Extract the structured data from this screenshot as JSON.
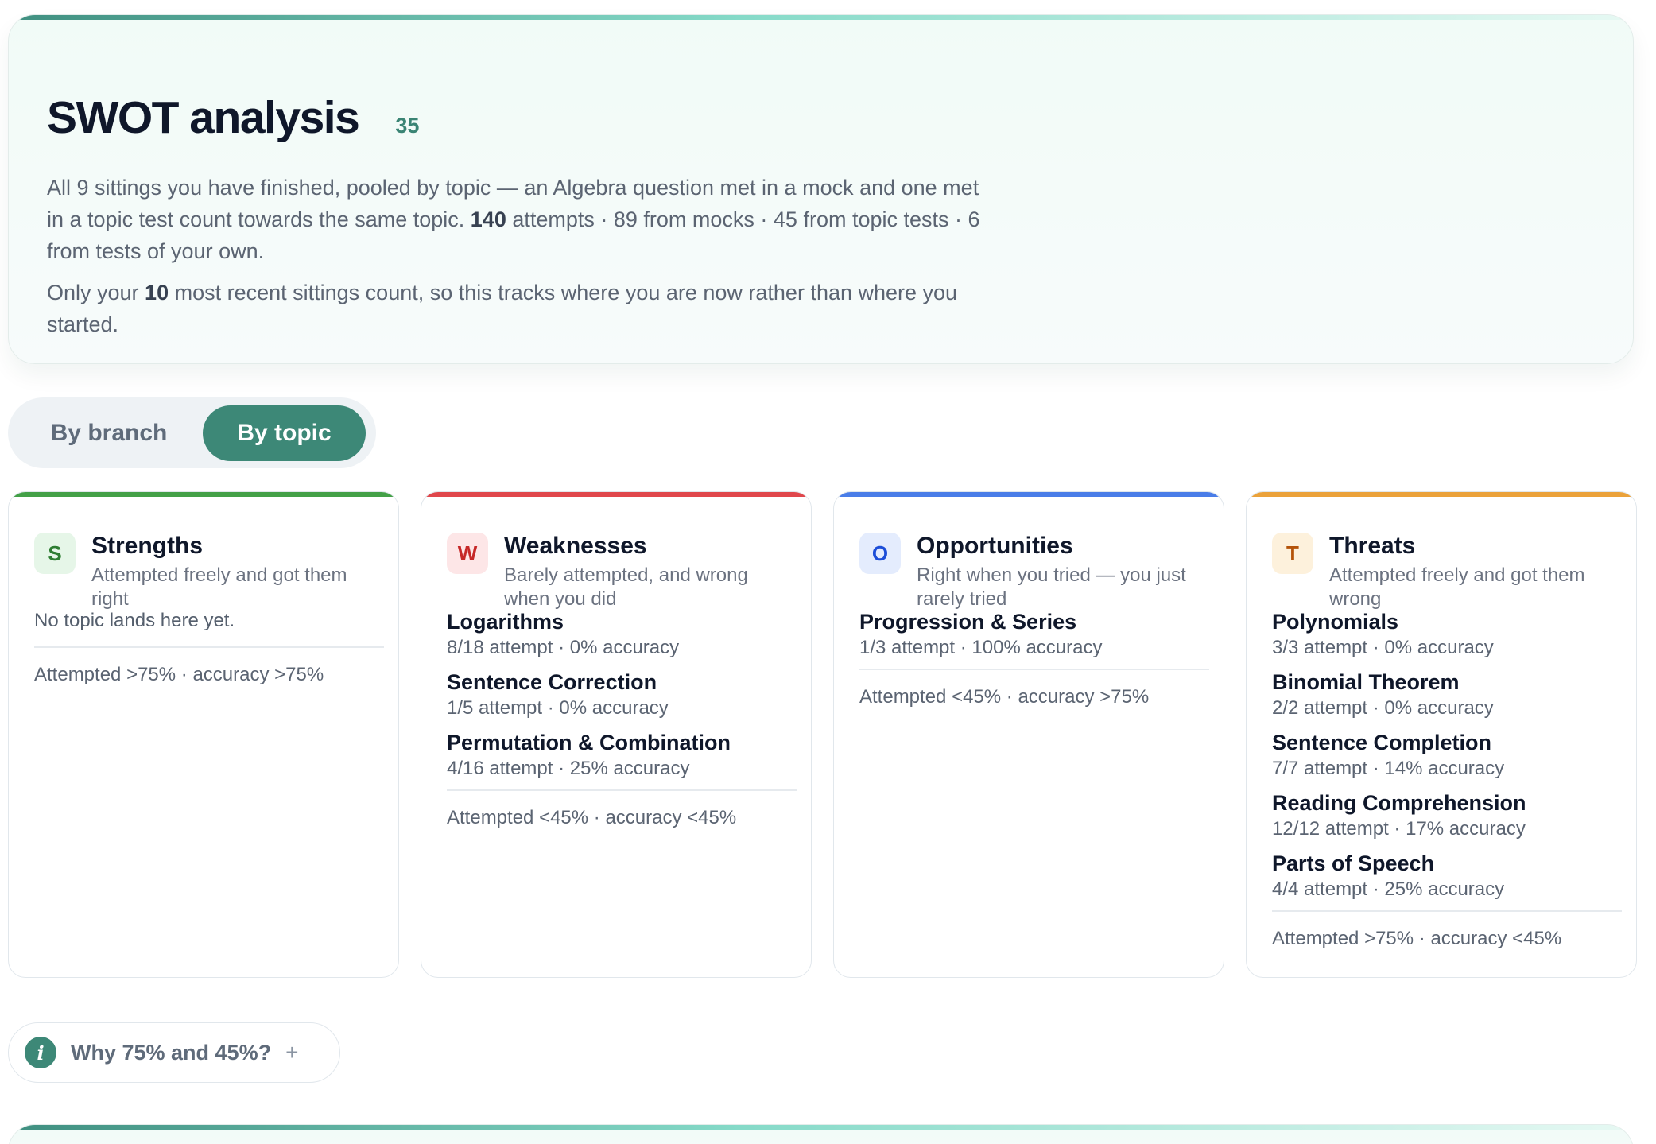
{
  "hero": {
    "title": "SWOT analysis",
    "count": "35",
    "p1_a": "All 9 sittings you have finished, pooled by topic — an Algebra question met in a mock and one met in a topic test count towards the same topic. ",
    "p1_attempts": "140",
    "p1_b": " attempts · 89 from mocks · 45 from topic tests · 6 from tests of your own.",
    "p2_a": "Only your ",
    "p2_recent": "10",
    "p2_b": " most recent sittings count, so this tracks where you are now rather than where you started."
  },
  "toggle": {
    "branch_label": "By branch",
    "topic_label": "By topic",
    "selected": "By topic"
  },
  "colors": {
    "strengths": "#43a047",
    "weaknesses": "#e0474c",
    "opportunities": "#4a7de8",
    "threats": "#eba23a",
    "primary": "#3d8877"
  },
  "cards": {
    "strengths": {
      "letter": "S",
      "title": "Strengths",
      "subtitle": "Attempted freely and got them right",
      "empty": "No topic lands here yet.",
      "criteria": "Attempted >75% · accuracy >75%"
    },
    "weaknesses": {
      "letter": "W",
      "title": "Weaknesses",
      "subtitle": "Barely attempted, and wrong when you did",
      "topics": [
        {
          "name": "Logarithms",
          "stats": "8/18 attempt · 0% accuracy"
        },
        {
          "name": "Sentence Correction",
          "stats": "1/5 attempt · 0% accuracy"
        },
        {
          "name": "Permutation & Combination",
          "stats": "4/16 attempt · 25% accuracy"
        }
      ],
      "criteria": "Attempted <45% · accuracy <45%"
    },
    "opportunities": {
      "letter": "O",
      "title": "Opportunities",
      "subtitle": "Right when you tried — you just rarely tried",
      "topics": [
        {
          "name": "Progression & Series",
          "stats": "1/3 attempt · 100% accuracy"
        }
      ],
      "criteria": "Attempted <45% · accuracy >75%"
    },
    "threats": {
      "letter": "T",
      "title": "Threats",
      "subtitle": "Attempted freely and got them wrong",
      "topics": [
        {
          "name": "Polynomials",
          "stats": "3/3 attempt · 0% accuracy"
        },
        {
          "name": "Binomial Theorem",
          "stats": "2/2 attempt · 0% accuracy"
        },
        {
          "name": "Sentence Completion",
          "stats": "7/7 attempt · 14% accuracy"
        },
        {
          "name": "Reading Comprehension",
          "stats": "12/12 attempt · 17% accuracy"
        },
        {
          "name": "Parts of Speech",
          "stats": "4/4 attempt · 25% accuracy"
        }
      ],
      "criteria": "Attempted >75% · accuracy <45%"
    }
  },
  "why": {
    "label": "Why 75% and 45%?",
    "icon": "info-icon",
    "expand_icon": "plus-icon"
  }
}
